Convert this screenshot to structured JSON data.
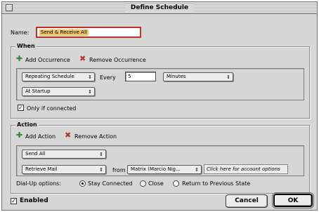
{
  "window": {
    "title": "Define Schedule"
  },
  "name": {
    "label": "Name:",
    "value": "Send & Receive All"
  },
  "when": {
    "title": "When",
    "add_label": "Add Occurrence",
    "remove_label": "Remove Occurrence",
    "schedule_type": "Repeating Schedule",
    "every_label": "Every",
    "every_value": "5",
    "unit": "Minutes",
    "secondary": "At Startup",
    "only_connected_label": "Only if connected",
    "only_connected_checked": true
  },
  "action": {
    "title": "Action",
    "add_label": "Add Action",
    "remove_label": "Remove Action",
    "action1": "Send All",
    "action2": "Retrieve Mail",
    "from_label": "from",
    "account": "Matrix (Marcio Nig...",
    "account_link": "Click here for account options"
  },
  "dialup": {
    "label": "Dial-Up options:",
    "options": [
      "Stay Connected",
      "Close",
      "Return to Previous State"
    ],
    "selected": "Stay Connected"
  },
  "footer": {
    "enabled_label": "Enabled",
    "enabled_checked": true,
    "cancel_label": "Cancel",
    "ok_label": "OK"
  },
  "colors": {
    "name_highlight": "#f2c26b",
    "focus_border": "#c0302a",
    "add_icon": "#2f8a2f",
    "remove_icon": "#c0302a"
  }
}
